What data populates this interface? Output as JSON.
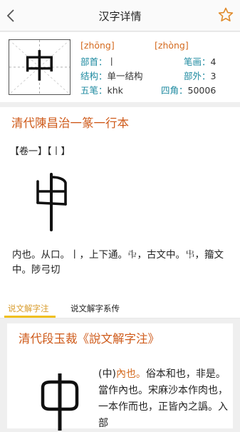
{
  "header": {
    "title": "汉字详情",
    "back_icon": "chevron-left-icon",
    "favorite_icon": "star-outline-icon"
  },
  "character": {
    "glyph": "中",
    "pinyin_1": "[zhōng]",
    "pinyin_2": "[zhòng]",
    "radical_label": "部首：",
    "radical_value": "丨",
    "strokes_label": "笔画：",
    "strokes_value": "4",
    "structure_label": "结构：",
    "structure_value": "单一结构",
    "outside_label": "部外：",
    "outside_value": "3",
    "wubi_label": "五笔：",
    "wubi_value": "khk",
    "sijiao_label": "四角：",
    "sijiao_value": "50006"
  },
  "section_1": {
    "title": "清代陳昌治一篆一行本",
    "volume": "【卷一】【丨】",
    "description": "内也。从口。丨，上下通。𠁩，古文中。𠁧，籀文中。陟弓切"
  },
  "tabs": [
    {
      "label": "说文解字注",
      "active": true
    },
    {
      "label": "说文解字系传",
      "active": false
    }
  ],
  "section_2": {
    "title": "清代段玉裁《說文解字注》",
    "desc_prefix": "(中)",
    "desc_highlight": "內也。",
    "desc_rest": "俗本和也，非是。當作內也。宋麻沙本作肉也，一本作而也，正皆內之譌。入部"
  },
  "colors": {
    "accent_orange": "#cf5b1b",
    "label_teal": "#1e8aa0",
    "tab_active": "#d89b2a",
    "tab_underline": "#f0c020"
  }
}
